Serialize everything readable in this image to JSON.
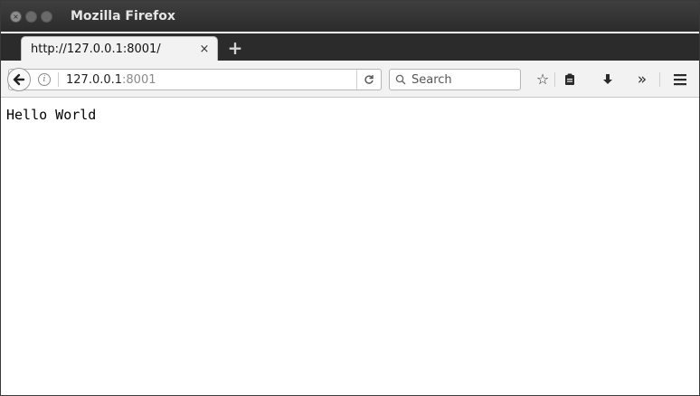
{
  "window": {
    "title": "Mozilla Firefox",
    "controls": {
      "close": "×",
      "minimize": "–",
      "maximize": "▫"
    }
  },
  "tabs": [
    {
      "title": "http://127.0.0.1:8001/",
      "close_icon": "×",
      "active": true
    }
  ],
  "new_tab_icon": "+",
  "navbar": {
    "back_icon": "🡐",
    "info_icon": "i",
    "url_host": "127.0.0.1",
    "url_port": ":8001",
    "reload_icon": "C",
    "search": {
      "placeholder": "Search",
      "icon": "magnifier-icon"
    },
    "toolbar_icons": {
      "bookmark": "☆",
      "reading_list": "▣",
      "downloads": "⬇",
      "overflow": "»",
      "menu": "≡"
    }
  },
  "page": {
    "body_text": "Hello World"
  }
}
